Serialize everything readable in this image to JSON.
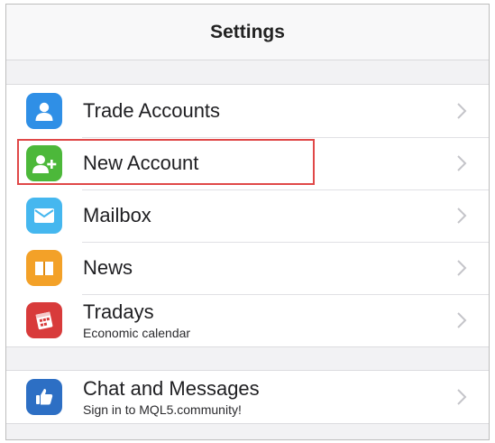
{
  "header": {
    "title": "Settings"
  },
  "group1": {
    "items": [
      {
        "label": "Trade Accounts",
        "icon": "user-icon",
        "color": "#2f8fe6"
      },
      {
        "label": "New Account",
        "icon": "add-user-icon",
        "color": "#4cb83a"
      },
      {
        "label": "Mailbox",
        "icon": "envelope-icon",
        "color": "#45b7ef"
      },
      {
        "label": "News",
        "icon": "book-icon",
        "color": "#f3a128"
      },
      {
        "label": "Tradays",
        "sublabel": "Economic calendar",
        "icon": "calendar-icon",
        "color": "#d83b3b"
      }
    ]
  },
  "group2": {
    "items": [
      {
        "label": "Chat and Messages",
        "sublabel": "Sign in to MQL5.community!",
        "icon": "thumbs-up-icon",
        "color": "#2d6fc4"
      }
    ]
  },
  "highlight_color": "#e04848"
}
